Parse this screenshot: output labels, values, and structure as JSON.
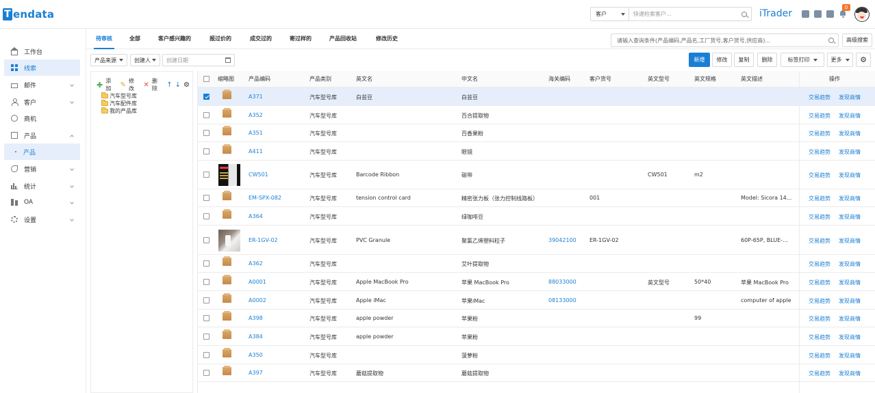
{
  "header": {
    "logo_text": "Tendata",
    "search_type": "客户",
    "search_placeholder": "快速检索客户...",
    "brand": "iTrader",
    "notification_count": "0"
  },
  "sidebar": {
    "items": [
      {
        "label": "工作台",
        "icon": "home-icon"
      },
      {
        "label": "线索",
        "icon": "grid-icon",
        "active": true
      },
      {
        "label": "邮件",
        "icon": "mail-icon",
        "expandable": true
      },
      {
        "label": "客户",
        "icon": "user-icon",
        "expandable": true
      },
      {
        "label": "商机",
        "icon": "opportunity-icon"
      },
      {
        "label": "产品",
        "icon": "product-icon",
        "expanded": true
      },
      {
        "label": "产品",
        "icon": "dot-icon",
        "sub": true,
        "active": true
      },
      {
        "label": "营销",
        "icon": "marketing-icon",
        "expandable": true
      },
      {
        "label": "统计",
        "icon": "bar-chart-icon",
        "expandable": true
      },
      {
        "label": "OA",
        "icon": "oa-icon",
        "expandable": true
      },
      {
        "label": "设置",
        "icon": "gear-icon",
        "expandable": true
      }
    ]
  },
  "tabs": [
    "待审核",
    "全部",
    "客户感兴趣的",
    "报过价的",
    "成交过的",
    "寄过样的",
    "产品回收站",
    "修改历史"
  ],
  "query": {
    "placeholder": "请输入查询条件(产品编码,产品名,工厂货号,客户货号,供应商)...",
    "advanced": "高级搜索"
  },
  "filters": {
    "source": "产品来源",
    "creator": "创建人",
    "date_placeholder": "创建日期"
  },
  "toolbar": {
    "new": "新增",
    "edit": "修改",
    "copy": "复制",
    "delete": "删除",
    "label_print": "标签打印",
    "more": "更多"
  },
  "tree": {
    "add": "添加",
    "edit": "修改",
    "delete": "删除",
    "nodes": [
      "汽车型号库",
      "汽车配件库",
      "我的产品库"
    ]
  },
  "table": {
    "headers": [
      "缩略图",
      "产品编码",
      "产品类别",
      "英文名",
      "中文名",
      "海关编码",
      "客户货号",
      "英文型号",
      "英文规格",
      "英文描述",
      "操作"
    ],
    "action1": "交易趋势",
    "action2": "发现商情",
    "rows": [
      {
        "code": "A371",
        "category": "汽车型号库",
        "en": "白芸豆",
        "cn": "白芸豆",
        "hs": "",
        "cust": "",
        "model": "",
        "spec": "",
        "desc": "",
        "checked": true
      },
      {
        "code": "A352",
        "category": "汽车型号库",
        "en": "",
        "cn": "百合提取物",
        "hs": "",
        "cust": "",
        "model": "",
        "spec": "",
        "desc": ""
      },
      {
        "code": "A351",
        "category": "汽车型号库",
        "en": "",
        "cn": "百香果粉",
        "hs": "",
        "cust": "",
        "model": "",
        "spec": "",
        "desc": ""
      },
      {
        "code": "A411",
        "category": "汽车型号库",
        "en": "",
        "cn": "眼镜",
        "hs": "",
        "cust": "",
        "model": "",
        "spec": "",
        "desc": ""
      },
      {
        "code": "CW501",
        "category": "汽车型号库",
        "en": "Barcode Ribbon",
        "cn": "碳带",
        "hs": "",
        "cust": "",
        "model": "CW501",
        "spec": "m2",
        "desc": "",
        "thumb": "barcode"
      },
      {
        "code": "EM-SPX-082",
        "category": "汽车型号库",
        "en": "tension control card",
        "cn": "精密张力板（张力控制线路板）",
        "hs": "",
        "cust": "001",
        "model": "",
        "spec": "",
        "desc": "Model: Sicora 14..."
      },
      {
        "code": "A364",
        "category": "汽车型号库",
        "en": "",
        "cn": "绿咖啡豆",
        "hs": "",
        "cust": "",
        "model": "",
        "spec": "",
        "desc": ""
      },
      {
        "code": "ER-1GV-02",
        "category": "汽车型号库",
        "en": "PVC Granule",
        "cn": "聚氯乙烯塑料粒子",
        "hs": "39042100",
        "cust": "ER-1GV-02",
        "model": "",
        "spec": "",
        "desc": "60P-65P, BLUE-...",
        "thumb": "pvc"
      },
      {
        "code": "A362",
        "category": "汽车型号库",
        "en": "",
        "cn": "艾叶提取物",
        "hs": "",
        "cust": "",
        "model": "",
        "spec": "",
        "desc": ""
      },
      {
        "code": "A0001",
        "category": "汽车型号库",
        "en": "Apple MacBook Pro",
        "cn": "苹果 MacBook Pro",
        "hs": "88033000",
        "cust": "",
        "model": "英文型号",
        "spec": "50*40",
        "desc": "苹果 MacBook Pro"
      },
      {
        "code": "A0002",
        "category": "汽车型号库",
        "en": "Apple iMac",
        "cn": "苹果iMac",
        "hs": "08133000",
        "cust": "",
        "model": "",
        "spec": "",
        "desc": "computer of apple"
      },
      {
        "code": "A398",
        "category": "汽车型号库",
        "en": "apple powder",
        "cn": "苹果粉",
        "hs": "",
        "cust": "",
        "model": "",
        "spec": "99",
        "desc": ""
      },
      {
        "code": "A384",
        "category": "汽车型号库",
        "en": "apple powder",
        "cn": "苹果粉",
        "hs": "",
        "cust": "",
        "model": "",
        "spec": "",
        "desc": ""
      },
      {
        "code": "A350",
        "category": "汽车型号库",
        "en": "",
        "cn": "菠萝粉",
        "hs": "",
        "cust": "",
        "model": "",
        "spec": "",
        "desc": ""
      },
      {
        "code": "A397",
        "category": "汽车型号库",
        "en": "蘑菇提取物",
        "cn": "蘑菇提取物",
        "hs": "",
        "cust": "",
        "model": "",
        "spec": "",
        "desc": ""
      }
    ]
  }
}
